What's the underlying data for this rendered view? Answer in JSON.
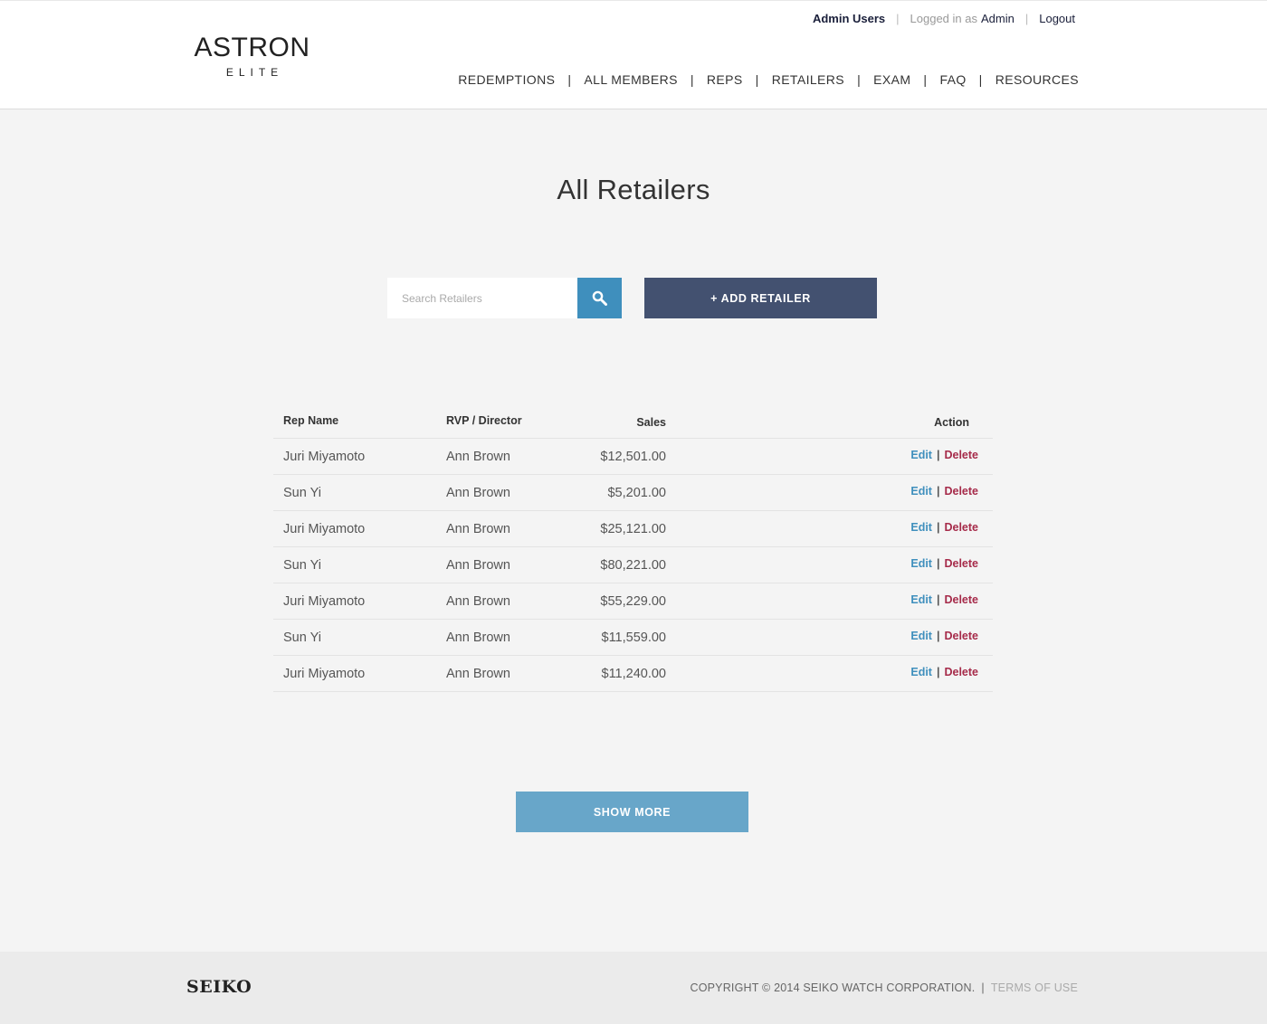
{
  "brand": {
    "name": "ASTRON",
    "sub": "ELITE"
  },
  "topbar": {
    "admin_users": "Admin Users",
    "logged_in_as": "Logged in as",
    "username": "Admin",
    "logout": "Logout"
  },
  "nav": [
    "REDEMPTIONS",
    "ALL MEMBERS",
    "REPS",
    "RETAILERS",
    "EXAM",
    "FAQ",
    "RESOURCES"
  ],
  "page_title": "All Retailers",
  "search": {
    "placeholder": "Search Retailers"
  },
  "add_button": "+ ADD RETAILER",
  "table": {
    "headers": {
      "rep": "Rep Name",
      "rvp": "RVP / Director",
      "sales": "Sales",
      "action": "Action"
    },
    "edit_label": "Edit",
    "delete_label": "Delete",
    "rows": [
      {
        "rep": "Juri Miyamoto",
        "rvp": "Ann Brown",
        "sales": "$12,501.00"
      },
      {
        "rep": "Sun Yi",
        "rvp": "Ann Brown",
        "sales": "$5,201.00"
      },
      {
        "rep": "Juri Miyamoto",
        "rvp": "Ann Brown",
        "sales": "$25,121.00"
      },
      {
        "rep": "Sun Yi",
        "rvp": "Ann Brown",
        "sales": "$80,221.00"
      },
      {
        "rep": "Juri Miyamoto",
        "rvp": "Ann Brown",
        "sales": "$55,229.00"
      },
      {
        "rep": "Sun Yi",
        "rvp": "Ann Brown",
        "sales": "$11,559.00"
      },
      {
        "rep": "Juri Miyamoto",
        "rvp": "Ann Brown",
        "sales": "$11,240.00"
      }
    ]
  },
  "show_more": "SHOW MORE",
  "footer": {
    "logo": "SEIKO",
    "copyright": "COPYRIGHT © 2014 SEIKO WATCH CORPORATION.",
    "terms": "TERMS OF USE"
  },
  "colors": {
    "accent": "#3f8fbd",
    "add_button": "#435170",
    "show_more": "#68a6c9",
    "delete": "#a62b4a"
  }
}
